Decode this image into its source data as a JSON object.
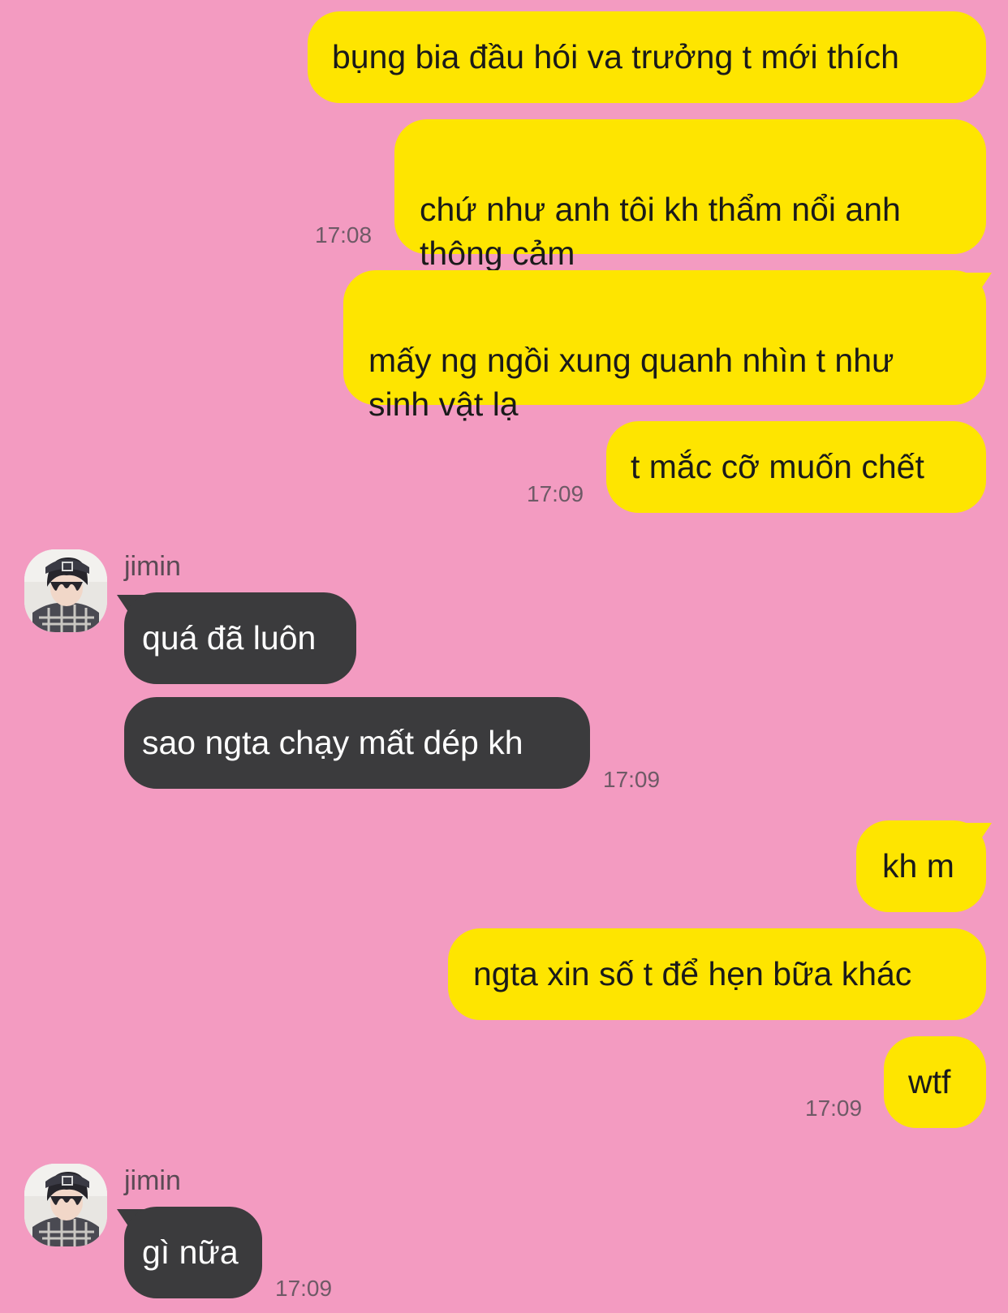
{
  "chat": {
    "messages": [
      {
        "text": "bụng bia đầu hói va trưởng t mới thích"
      },
      {
        "text": "chứ như anh tôi kh thẩm nổi anh\nthông cảm",
        "time": "17:08"
      },
      {
        "text": "mấy ng ngồi xung quanh nhìn t như\nsinh vật lạ"
      },
      {
        "text": "t mắc cỡ muốn chết",
        "time": "17:09"
      },
      {
        "sender": "jimin",
        "text": "quá đã luôn"
      },
      {
        "text": "sao ngta chạy mất dép kh",
        "time": "17:09"
      },
      {
        "text": "kh m"
      },
      {
        "text": "ngta xin số t để hẹn bữa khác"
      },
      {
        "text": "wtf",
        "time": "17:09"
      },
      {
        "sender": "jimin",
        "text": "gì nữa",
        "time": "17:09"
      }
    ]
  },
  "colors": {
    "background": "#f39bc1",
    "outgoing_bubble": "#fee500",
    "incoming_bubble": "#3b3b3d"
  },
  "icons": {
    "avatar": "profile-photo"
  }
}
